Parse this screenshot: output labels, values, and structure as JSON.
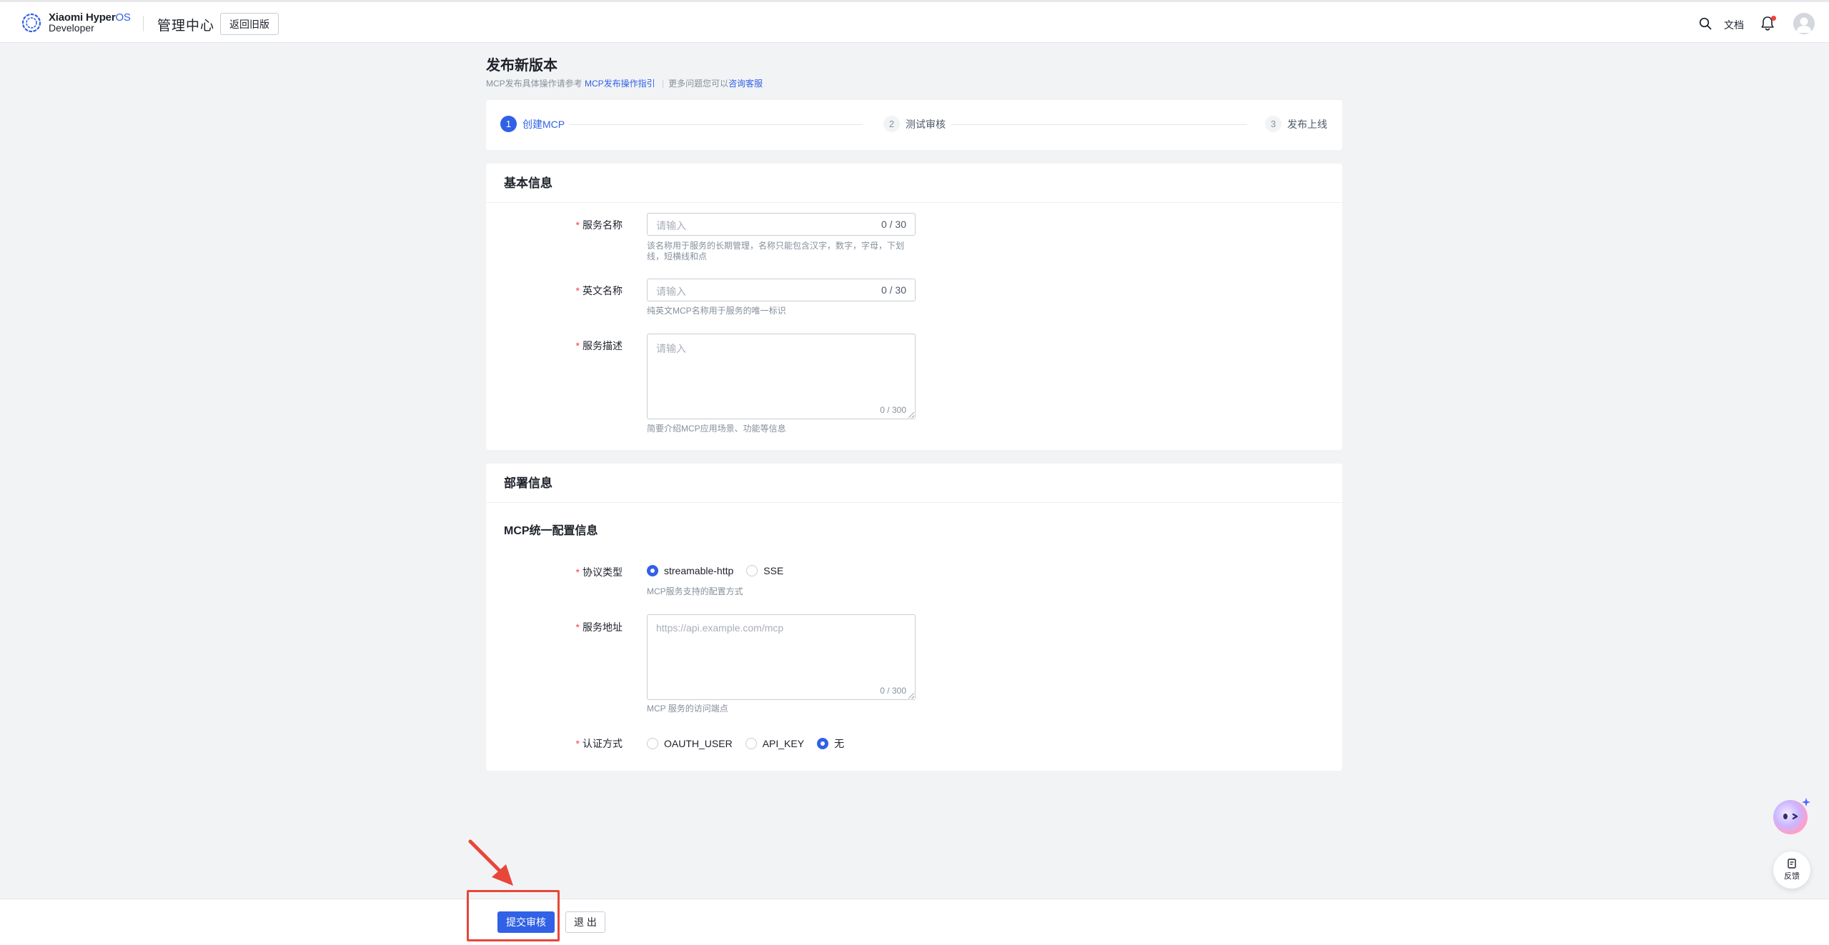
{
  "header": {
    "logo_brand": "Xiaomi Hyper",
    "logo_brand_suffix": "OS",
    "logo_sub": "Developer",
    "admin_title": "管理中心",
    "back_old_label": "返回旧版",
    "docs_label": "文档",
    "icons": [
      "search-icon",
      "bell-icon",
      "avatar"
    ]
  },
  "page": {
    "title": "发布新版本",
    "sub_prefix": "MCP发布具体操作请参考",
    "sub_link1": "MCP发布操作指引",
    "sub_sep": "|",
    "sub_middle": "更多问题您可以",
    "sub_link2": "咨询客服"
  },
  "steps": [
    {
      "num": "1",
      "label": "创建MCP",
      "state": "active"
    },
    {
      "num": "2",
      "label": "测试审核",
      "state": "idle"
    },
    {
      "num": "3",
      "label": "发布上线",
      "state": "idle"
    }
  ],
  "basic": {
    "title": "基本信息",
    "service_name": {
      "label": "服务名称",
      "placeholder": "请输入",
      "count": "0 / 30",
      "help": "该名称用于服务的长期管理，名称只能包含汉字，数字，字母，下划线，短横线和点"
    },
    "english_name": {
      "label": "英文名称",
      "placeholder": "请输入",
      "count": "0 / 30",
      "help": "纯英文MCP名称用于服务的唯一标识"
    },
    "description": {
      "label": "服务描述",
      "placeholder": "请输入",
      "count": "0 / 300",
      "help": "简要介绍MCP应用场景、功能等信息"
    }
  },
  "deploy": {
    "title": "部署信息",
    "subtitle": "MCP统一配置信息",
    "protocol": {
      "label": "协议类型",
      "options": [
        "streamable-http",
        "SSE"
      ],
      "selected": "streamable-http",
      "help": "MCP服务支持的配置方式"
    },
    "address": {
      "label": "服务地址",
      "placeholder": "https://api.example.com/mcp",
      "count": "0 / 300",
      "help": "MCP 服务的访问端点"
    },
    "auth": {
      "label": "认证方式",
      "options": [
        "OAUTH_USER",
        "API_KEY",
        "无"
      ],
      "selected": "无"
    }
  },
  "footer": {
    "submit_label": "提交审核",
    "exit_label": "退 出"
  },
  "floating": {
    "feedback_label": "反馈"
  },
  "colors": {
    "accent": "#3061e6",
    "required": "#f53f3f",
    "annotation": "#e8463a"
  }
}
